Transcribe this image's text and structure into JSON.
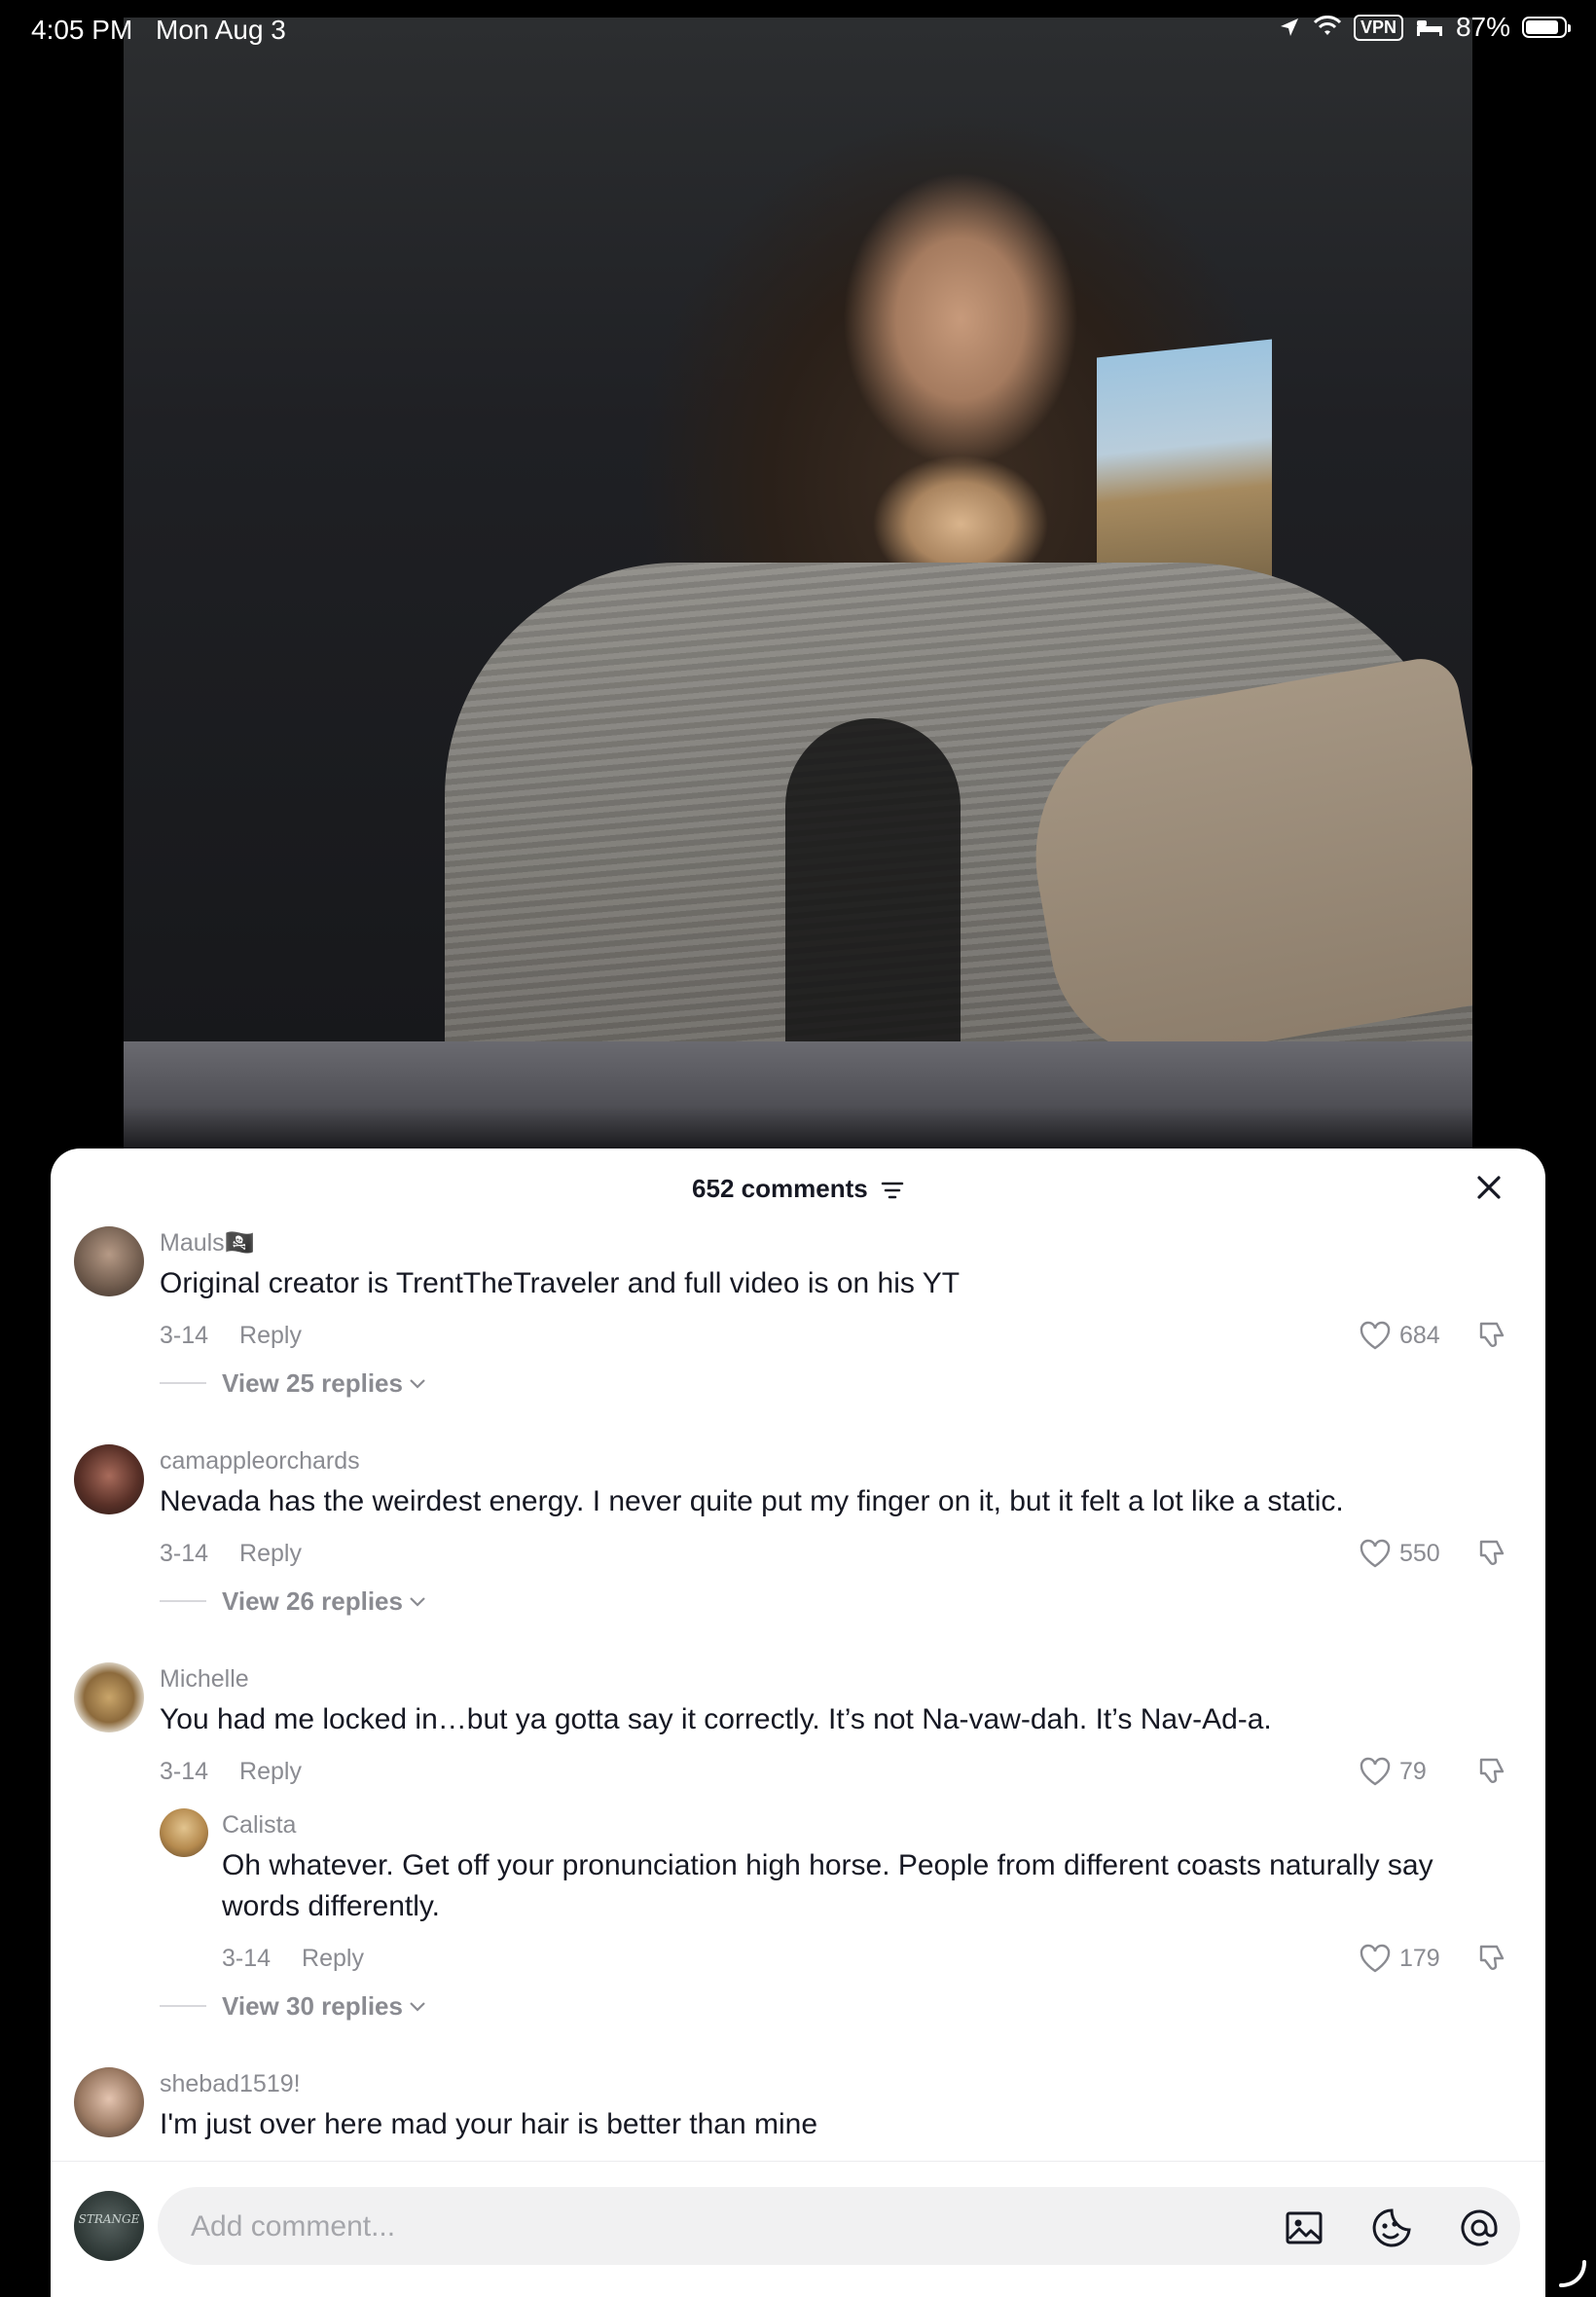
{
  "status_bar": {
    "time": "4:05 PM",
    "date": "Mon Aug 3",
    "vpn": "VPN",
    "battery": "87%"
  },
  "sheet": {
    "title": "652 comments",
    "close_label": "Close"
  },
  "comments": [
    {
      "user": "Mauls🏴‍☠️",
      "text": "Original creator is TrentTheTraveler and full video is on his YT",
      "date": "3-14",
      "reply_label": "Reply",
      "likes": "684",
      "view_replies": "View 25 replies"
    },
    {
      "user": "camappleorchards",
      "text": "Nevada has the weirdest energy. I never quite put my finger on it, but it felt a lot like a static.",
      "date": "3-14",
      "reply_label": "Reply",
      "likes": "550",
      "view_replies": "View 26 replies"
    },
    {
      "user": "Michelle",
      "text": "You had me locked in…but ya gotta say it correctly. It’s not Na-vaw-dah. It’s Nav-Ad-a.",
      "date": "3-14",
      "reply_label": "Reply",
      "likes": "79",
      "reply": {
        "user": "Calista",
        "text": "Oh whatever. Get off your pronunciation high horse. People from different coasts naturally say words differently.",
        "date": "3-14",
        "reply_label": "Reply",
        "likes": "179"
      },
      "view_replies": "View 30 replies"
    },
    {
      "user": "shebad1519!",
      "text": "I'm just over here mad your hair is better than mine"
    }
  ],
  "composer": {
    "placeholder": "Add comment...",
    "avatar_text": "STRANGE"
  },
  "colors": {
    "accent_text": "#161823",
    "muted_text": "#8a8b91",
    "sheet_bg": "#ffffff"
  },
  "icons": [
    "location-arrow-icon",
    "wifi-icon",
    "bed-icon",
    "battery-icon",
    "filter-icon",
    "close-icon",
    "heart-icon",
    "dislike-icon",
    "chevron-down-icon",
    "image-icon",
    "sticker-icon",
    "mention-icon"
  ]
}
